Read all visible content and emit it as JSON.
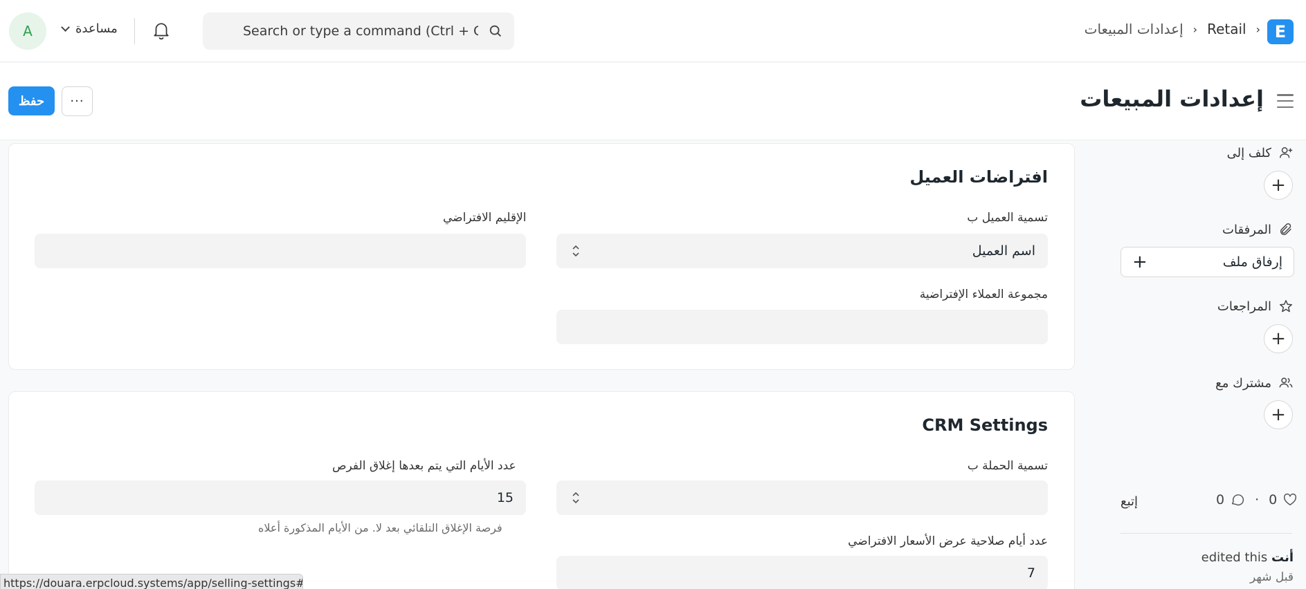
{
  "navbar": {
    "avatar_initial": "A",
    "help_label": "مساعدة",
    "search_placeholder": "Search or type a command (Ctrl + G)",
    "breadcrumb": [
      "Retail",
      "إعدادات المبيعات"
    ],
    "app_logo": "E",
    "brand_color": "#2490ef"
  },
  "page": {
    "title": "إعدادات المبيعات",
    "save_label": "حفظ",
    "more_label": "···"
  },
  "customer_defaults": {
    "title": "افتراضات العميل",
    "customer_naming_label": "تسمية العميل ب",
    "customer_naming_value": "اسم العميل",
    "default_territory_label": "الإقليم الافتراضي",
    "default_territory_value": "",
    "default_customer_group_label": "مجموعة العملاء الإفتراضية",
    "default_customer_group_value": ""
  },
  "crm_settings": {
    "title": "CRM Settings",
    "campaign_naming_label": "تسمية الحملة ب",
    "campaign_naming_value": "",
    "close_opportunity_label": "عدد الأيام التي يتم بعدها إغلاق الفرص",
    "close_opportunity_value": "15",
    "close_opportunity_help": "فرصة الإغلاق التلقائي بعد لا. من الأيام المذكورة أعلاه",
    "quotation_validity_label": "عدد أيام صلاحية عرض الأسعار الافتراضي",
    "quotation_validity_value": "7"
  },
  "sidebar": {
    "assigned_to_label": "كلف إلى",
    "attachments_label": "المرفقات",
    "attach_file_label": "إرفاق ملف",
    "reviews_label": "المراجعات",
    "shared_with_label": "مشترك مع",
    "follow_label": "إتبع",
    "likes_count": "0",
    "comments_count": "0",
    "activity_user": "أنت",
    "activity_text": "edited this",
    "activity_time": "قبل شهر"
  },
  "status_bar": {
    "url": "https://douara.erpcloud.systems/app/selling-settings#"
  }
}
